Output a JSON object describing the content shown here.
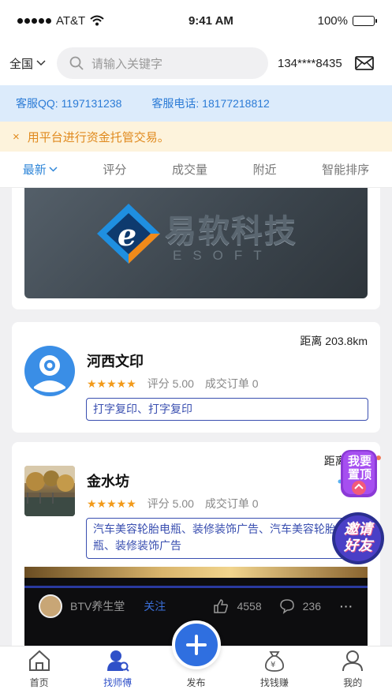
{
  "status_bar": {
    "carrier": "AT&T",
    "time": "9:41 AM",
    "battery": "100%",
    "battery_level": 1.0
  },
  "search_bar": {
    "region": "全国",
    "placeholder": "请输入关键字",
    "phone": "134****8435"
  },
  "service": {
    "qq_label": "客服QQ:",
    "qq": "1197131238",
    "tel_label": "客服电话:",
    "tel": "18177218812"
  },
  "notice": {
    "close": "×",
    "text": "用平台进行资金托管交易。"
  },
  "sort_tabs": [
    {
      "label": "最新"
    },
    {
      "label": "评分"
    },
    {
      "label": "成交量"
    },
    {
      "label": "附近"
    },
    {
      "label": "智能排序"
    }
  ],
  "banner": {
    "title": "易软科技",
    "subtitle": "ESOFT"
  },
  "shops": [
    {
      "name": "河西文印",
      "distance": "距离 203.8km",
      "stars": "★★★★★",
      "score": "评分 5.00",
      "orders": "成交订单 0",
      "tags": "打字复印、打字复印"
    },
    {
      "name": "金水坊",
      "distance": "距离 203",
      "stars": "★★★★★",
      "score": "评分 5.00",
      "orders": "成交订单 0",
      "tags": "汽车美容轮胎电瓶、装修装饰广告、汽车美容轮胎电瓶、装修装饰广告"
    }
  ],
  "video": {
    "channel": "BTV养生堂",
    "follow": "关注",
    "likes": "4558",
    "comments": "236",
    "more": "···"
  },
  "float_buttons": {
    "top_line1": "我要",
    "top_line2": "置顶",
    "invite_line1": "邀请",
    "invite_line2": "好友"
  },
  "tabbar": [
    {
      "label": "首页",
      "icon": "home-icon"
    },
    {
      "label": "找师傅",
      "icon": "find-master-icon"
    },
    {
      "label": "发布",
      "icon": "publish-icon"
    },
    {
      "label": "找钱赚",
      "icon": "money-bag-icon"
    },
    {
      "label": "我的",
      "icon": "profile-icon"
    }
  ],
  "colors": {
    "accent": "#2f86d8",
    "tag": "#3a4fb0",
    "star": "#f29a1a",
    "notice": "#e08a1e"
  }
}
